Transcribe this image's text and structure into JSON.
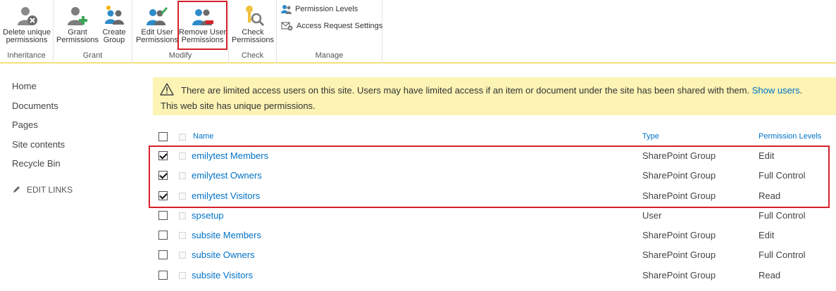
{
  "ribbon": {
    "groups": {
      "inheritance": "Inheritance",
      "grant": "Grant",
      "modify": "Modify",
      "check": "Check",
      "manage": "Manage"
    },
    "buttons": {
      "delete_unique": "Delete unique\npermissions",
      "grant_permissions": "Grant\nPermissions",
      "create_group": "Create\nGroup",
      "edit_user_permissions": "Edit User\nPermissions",
      "remove_user_permissions": "Remove User\nPermissions",
      "check_permissions": "Check\nPermissions",
      "permission_levels": "Permission Levels",
      "access_request_settings": "Access Request Settings"
    }
  },
  "leftnav": {
    "items": [
      "Home",
      "Documents",
      "Pages",
      "Site contents",
      "Recycle Bin"
    ],
    "edit_links": "EDIT LINKS"
  },
  "banner": {
    "message": "There are limited access users on this site. Users may have limited access if an item or document under the site has been shared with them.",
    "link": "Show users",
    "link_suffix": ".",
    "unique_note": "This web site has unique permissions."
  },
  "table": {
    "headers": {
      "name": "Name",
      "type": "Type",
      "permission_levels": "Permission Levels"
    },
    "rows": [
      {
        "name": "emilytest Members",
        "type": "SharePoint Group",
        "permission": "Edit",
        "checked": true
      },
      {
        "name": "emilytest Owners",
        "type": "SharePoint Group",
        "permission": "Full Control",
        "checked": true
      },
      {
        "name": "emilytest Visitors",
        "type": "SharePoint Group",
        "permission": "Read",
        "checked": true
      },
      {
        "name": "spsetup",
        "type": "User",
        "permission": "Full Control",
        "checked": false
      },
      {
        "name": "subsite Members",
        "type": "SharePoint Group",
        "permission": "Edit",
        "checked": false
      },
      {
        "name": "subsite Owners",
        "type": "SharePoint Group",
        "permission": "Full Control",
        "checked": false
      },
      {
        "name": "subsite Visitors",
        "type": "SharePoint Group",
        "permission": "Read",
        "checked": false
      }
    ]
  },
  "colors": {
    "link": "#0072c6",
    "banner": "#fcf3b4",
    "highlight": "#d6202a",
    "ribbon_rule": "#e8c800"
  }
}
